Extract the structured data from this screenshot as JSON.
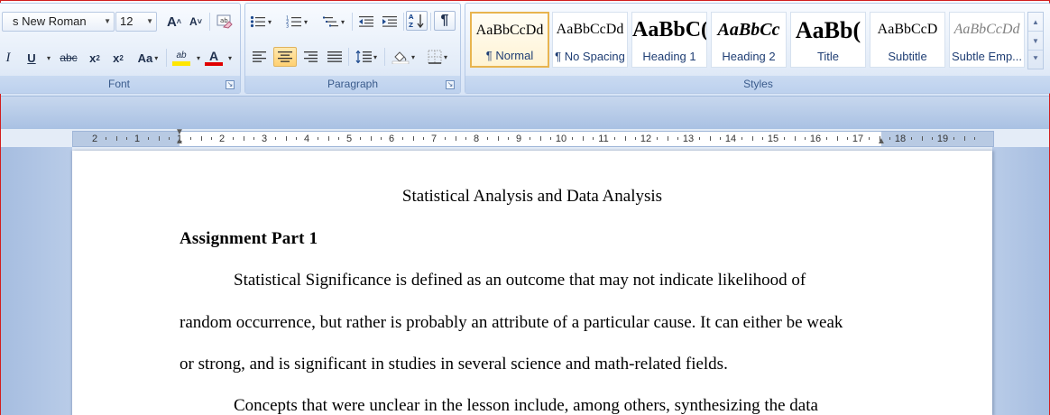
{
  "ribbon": {
    "font": {
      "label": "Font",
      "font_name": "s New Roman",
      "font_size": "12",
      "grow_label": "A",
      "shrink_label": "A",
      "italic": "I",
      "underline": "U",
      "strike": "abc",
      "subscript": "x",
      "superscript": "x",
      "change_case": "Aa",
      "highlight": "ab",
      "font_color_letter": "A",
      "highlight_color": "#ffe600",
      "font_color": "#e00000"
    },
    "paragraph": {
      "label": "Paragraph",
      "pilcrow": "¶"
    },
    "styles": {
      "label": "Styles",
      "items": [
        {
          "preview": "AaBbCcDd",
          "name": "¶ Normal"
        },
        {
          "preview": "AaBbCcDd",
          "name": "¶ No Spacing"
        },
        {
          "preview": "AaBbC(",
          "name": "Heading 1"
        },
        {
          "preview": "AaBbCc",
          "name": "Heading 2"
        },
        {
          "preview": "AaBb(",
          "name": "Title"
        },
        {
          "preview": "AaBbCcD",
          "name": "Subtitle"
        },
        {
          "preview": "AaBbCcDd",
          "name": "Subtle Emp..."
        }
      ]
    }
  },
  "ruler": {
    "numbers": [
      "2",
      "1",
      "1",
      "2",
      "3",
      "4",
      "5",
      "6",
      "7",
      "8",
      "9",
      "10",
      "11",
      "12",
      "13",
      "14",
      "15",
      "16",
      "17",
      "18",
      "19"
    ]
  },
  "document": {
    "title": "Statistical Analysis and Data Analysis",
    "heading": "Assignment Part 1",
    "lines": [
      "Statistical Significance is defined as an outcome that may not indicate likelihood of",
      "random occurrence, but rather is probably an attribute of a particular cause. It can either be weak",
      "or strong, and is significant in studies in several science and math-related fields.",
      "Concepts that were unclear in the lesson include, among others, synthesizing the data"
    ]
  }
}
